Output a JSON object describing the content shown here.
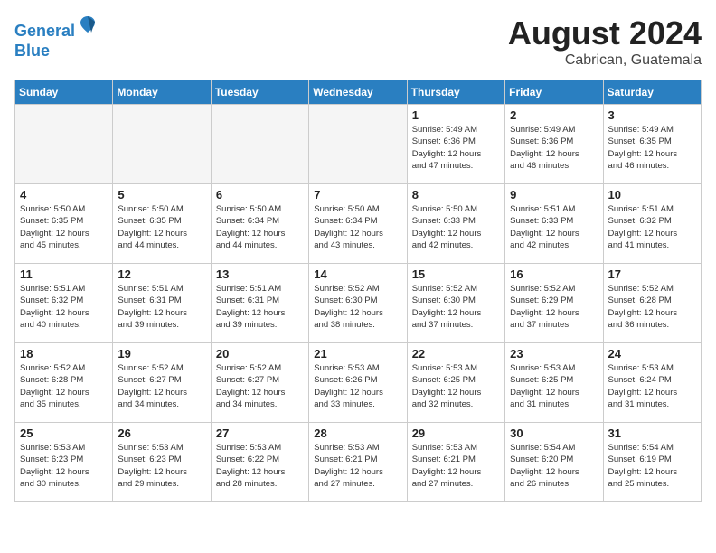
{
  "header": {
    "logo_line1": "General",
    "logo_line2": "Blue",
    "title": "August 2024",
    "subtitle": "Cabrican, Guatemala"
  },
  "days_of_week": [
    "Sunday",
    "Monday",
    "Tuesday",
    "Wednesday",
    "Thursday",
    "Friday",
    "Saturday"
  ],
  "weeks": [
    [
      {
        "day": "",
        "info": ""
      },
      {
        "day": "",
        "info": ""
      },
      {
        "day": "",
        "info": ""
      },
      {
        "day": "",
        "info": ""
      },
      {
        "day": "1",
        "info": "Sunrise: 5:49 AM\nSunset: 6:36 PM\nDaylight: 12 hours\nand 47 minutes."
      },
      {
        "day": "2",
        "info": "Sunrise: 5:49 AM\nSunset: 6:36 PM\nDaylight: 12 hours\nand 46 minutes."
      },
      {
        "day": "3",
        "info": "Sunrise: 5:49 AM\nSunset: 6:35 PM\nDaylight: 12 hours\nand 46 minutes."
      }
    ],
    [
      {
        "day": "4",
        "info": "Sunrise: 5:50 AM\nSunset: 6:35 PM\nDaylight: 12 hours\nand 45 minutes."
      },
      {
        "day": "5",
        "info": "Sunrise: 5:50 AM\nSunset: 6:35 PM\nDaylight: 12 hours\nand 44 minutes."
      },
      {
        "day": "6",
        "info": "Sunrise: 5:50 AM\nSunset: 6:34 PM\nDaylight: 12 hours\nand 44 minutes."
      },
      {
        "day": "7",
        "info": "Sunrise: 5:50 AM\nSunset: 6:34 PM\nDaylight: 12 hours\nand 43 minutes."
      },
      {
        "day": "8",
        "info": "Sunrise: 5:50 AM\nSunset: 6:33 PM\nDaylight: 12 hours\nand 42 minutes."
      },
      {
        "day": "9",
        "info": "Sunrise: 5:51 AM\nSunset: 6:33 PM\nDaylight: 12 hours\nand 42 minutes."
      },
      {
        "day": "10",
        "info": "Sunrise: 5:51 AM\nSunset: 6:32 PM\nDaylight: 12 hours\nand 41 minutes."
      }
    ],
    [
      {
        "day": "11",
        "info": "Sunrise: 5:51 AM\nSunset: 6:32 PM\nDaylight: 12 hours\nand 40 minutes."
      },
      {
        "day": "12",
        "info": "Sunrise: 5:51 AM\nSunset: 6:31 PM\nDaylight: 12 hours\nand 39 minutes."
      },
      {
        "day": "13",
        "info": "Sunrise: 5:51 AM\nSunset: 6:31 PM\nDaylight: 12 hours\nand 39 minutes."
      },
      {
        "day": "14",
        "info": "Sunrise: 5:52 AM\nSunset: 6:30 PM\nDaylight: 12 hours\nand 38 minutes."
      },
      {
        "day": "15",
        "info": "Sunrise: 5:52 AM\nSunset: 6:30 PM\nDaylight: 12 hours\nand 37 minutes."
      },
      {
        "day": "16",
        "info": "Sunrise: 5:52 AM\nSunset: 6:29 PM\nDaylight: 12 hours\nand 37 minutes."
      },
      {
        "day": "17",
        "info": "Sunrise: 5:52 AM\nSunset: 6:28 PM\nDaylight: 12 hours\nand 36 minutes."
      }
    ],
    [
      {
        "day": "18",
        "info": "Sunrise: 5:52 AM\nSunset: 6:28 PM\nDaylight: 12 hours\nand 35 minutes."
      },
      {
        "day": "19",
        "info": "Sunrise: 5:52 AM\nSunset: 6:27 PM\nDaylight: 12 hours\nand 34 minutes."
      },
      {
        "day": "20",
        "info": "Sunrise: 5:52 AM\nSunset: 6:27 PM\nDaylight: 12 hours\nand 34 minutes."
      },
      {
        "day": "21",
        "info": "Sunrise: 5:53 AM\nSunset: 6:26 PM\nDaylight: 12 hours\nand 33 minutes."
      },
      {
        "day": "22",
        "info": "Sunrise: 5:53 AM\nSunset: 6:25 PM\nDaylight: 12 hours\nand 32 minutes."
      },
      {
        "day": "23",
        "info": "Sunrise: 5:53 AM\nSunset: 6:25 PM\nDaylight: 12 hours\nand 31 minutes."
      },
      {
        "day": "24",
        "info": "Sunrise: 5:53 AM\nSunset: 6:24 PM\nDaylight: 12 hours\nand 31 minutes."
      }
    ],
    [
      {
        "day": "25",
        "info": "Sunrise: 5:53 AM\nSunset: 6:23 PM\nDaylight: 12 hours\nand 30 minutes."
      },
      {
        "day": "26",
        "info": "Sunrise: 5:53 AM\nSunset: 6:23 PM\nDaylight: 12 hours\nand 29 minutes."
      },
      {
        "day": "27",
        "info": "Sunrise: 5:53 AM\nSunset: 6:22 PM\nDaylight: 12 hours\nand 28 minutes."
      },
      {
        "day": "28",
        "info": "Sunrise: 5:53 AM\nSunset: 6:21 PM\nDaylight: 12 hours\nand 27 minutes."
      },
      {
        "day": "29",
        "info": "Sunrise: 5:53 AM\nSunset: 6:21 PM\nDaylight: 12 hours\nand 27 minutes."
      },
      {
        "day": "30",
        "info": "Sunrise: 5:54 AM\nSunset: 6:20 PM\nDaylight: 12 hours\nand 26 minutes."
      },
      {
        "day": "31",
        "info": "Sunrise: 5:54 AM\nSunset: 6:19 PM\nDaylight: 12 hours\nand 25 minutes."
      }
    ]
  ]
}
